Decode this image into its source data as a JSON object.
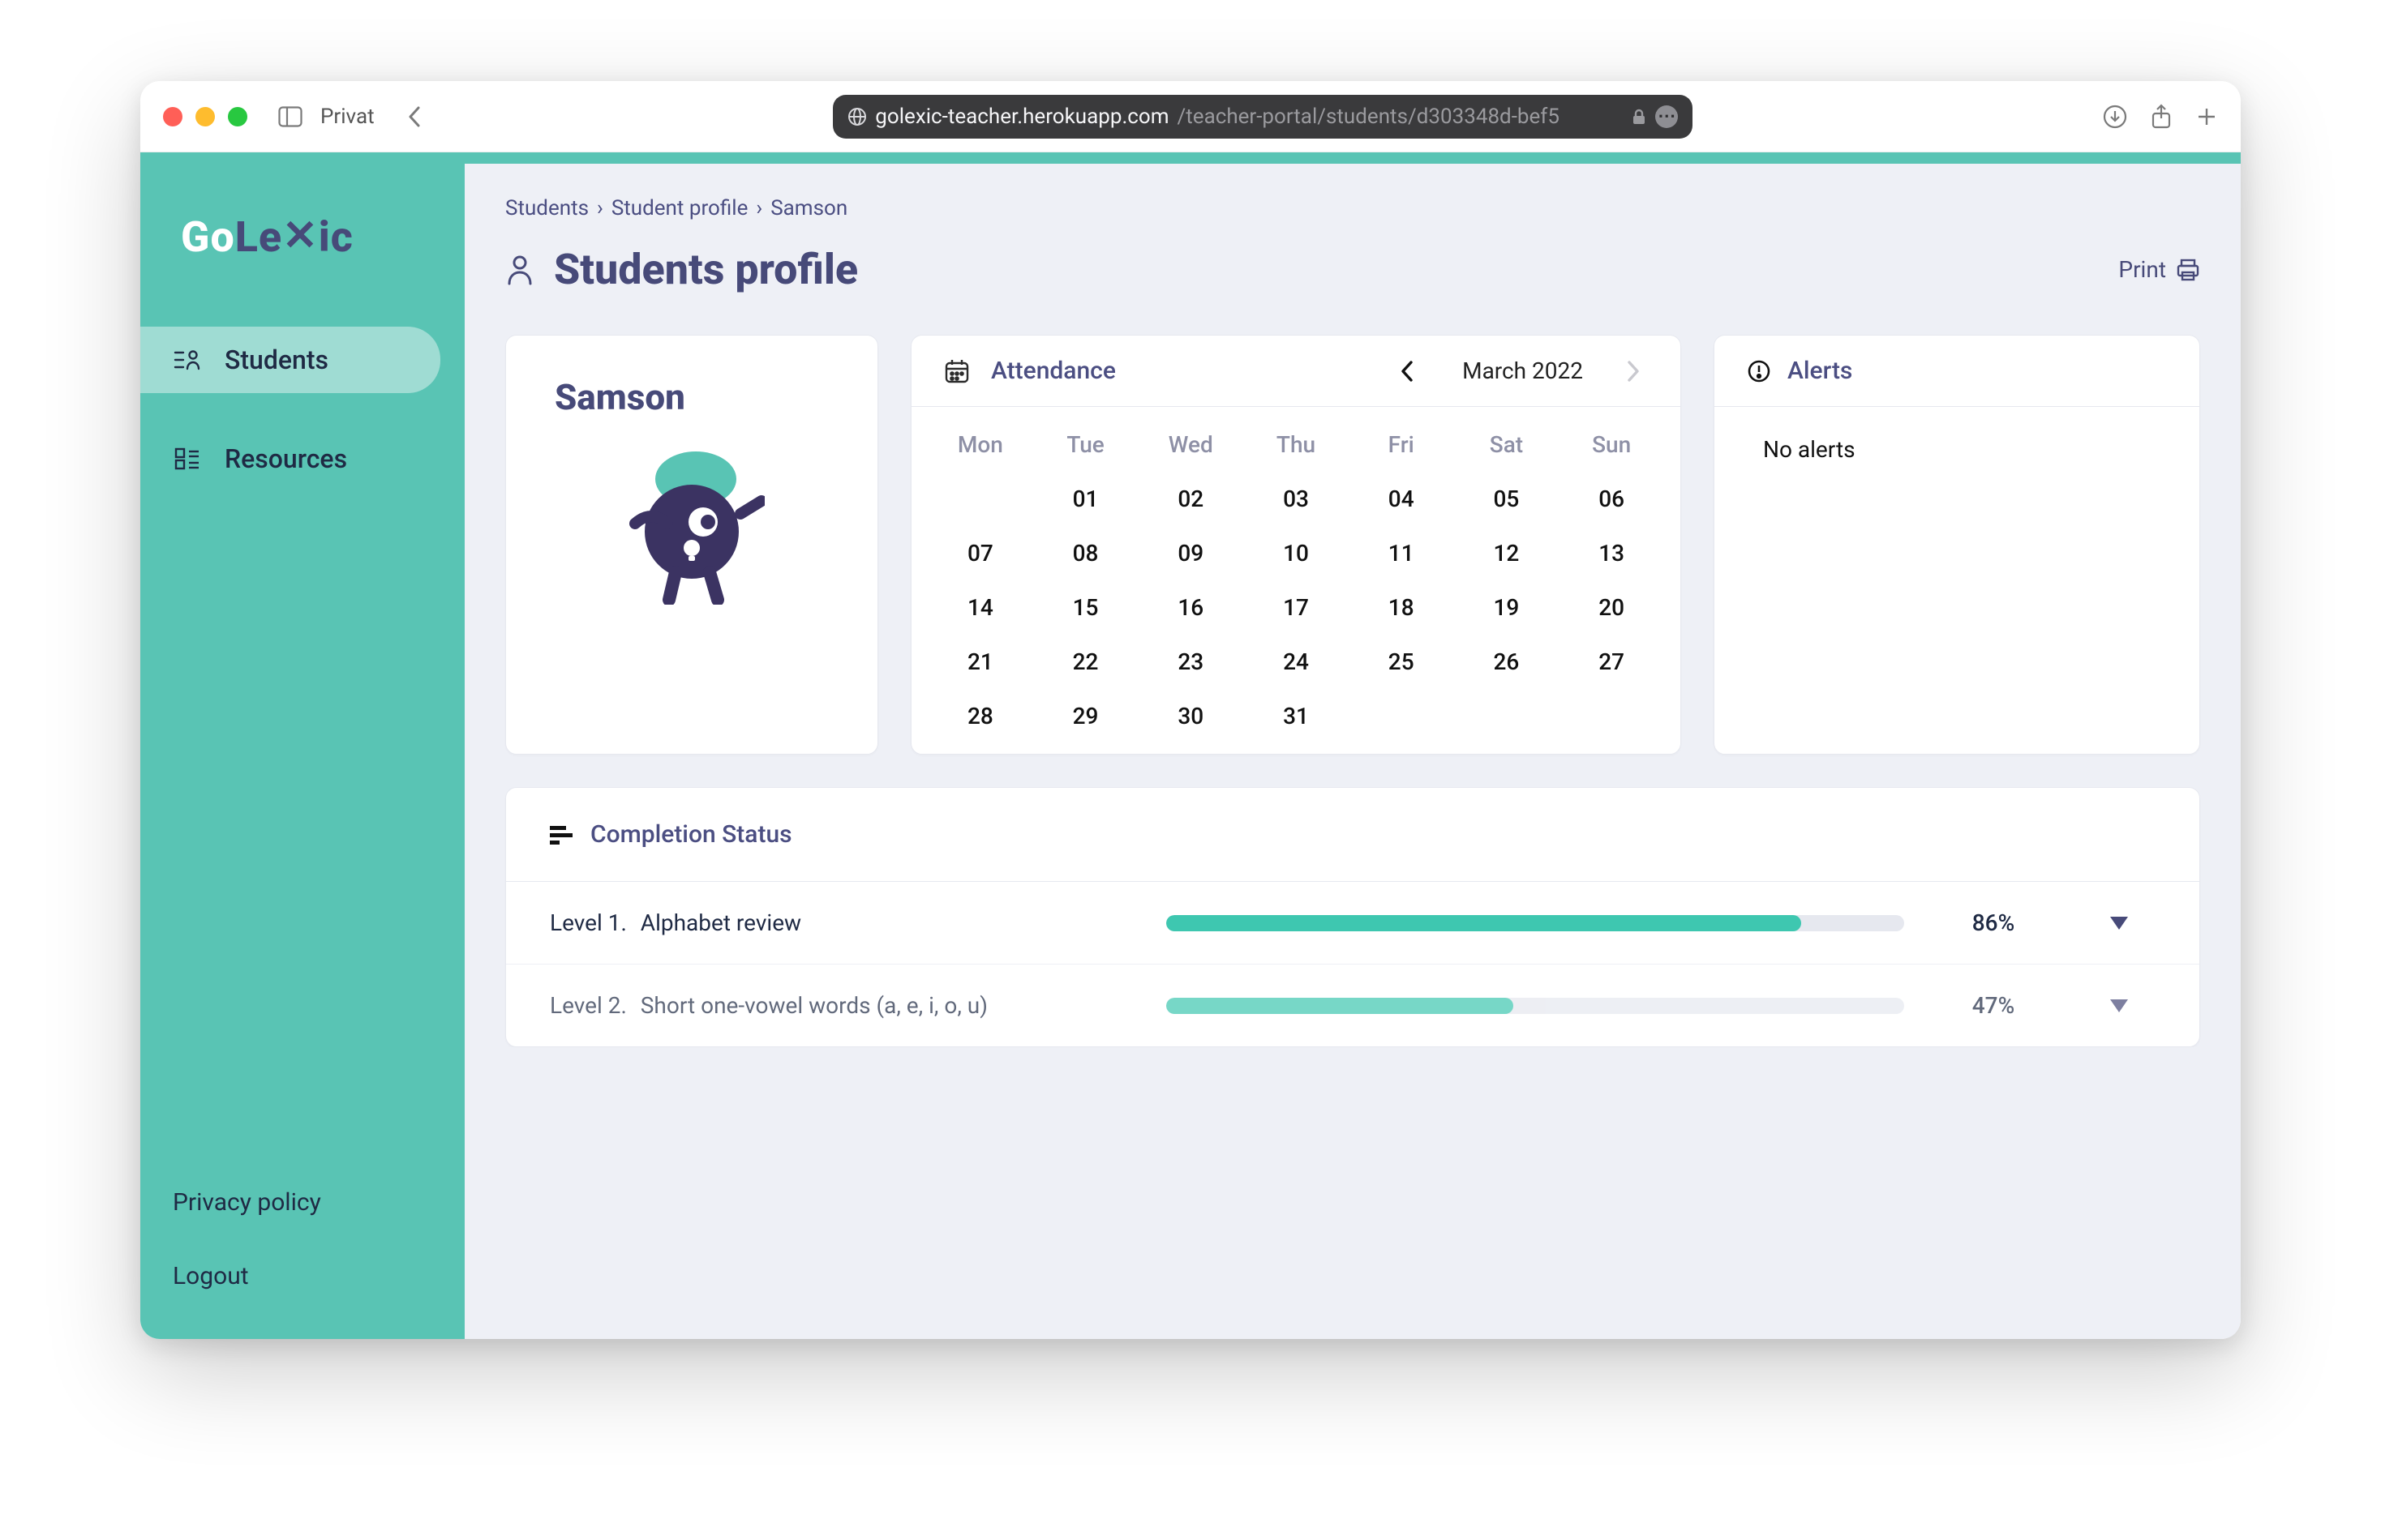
{
  "browser": {
    "privat_label": "Privat",
    "url_host": "golexic-teacher.herokuapp.com",
    "url_path": "/teacher-portal/students/d303348d-bef5"
  },
  "brand": {
    "go": "Go",
    "lex": "Le",
    "x": "✕",
    "ic": "ic"
  },
  "sidebar": {
    "items": [
      {
        "label": "Students",
        "icon": "students-icon",
        "active": true
      },
      {
        "label": "Resources",
        "icon": "resources-icon",
        "active": false
      }
    ],
    "footer": {
      "privacy_label": "Privacy policy",
      "logout_label": "Logout"
    }
  },
  "breadcrumb": {
    "items": [
      "Students",
      "Student profile",
      "Samson"
    ]
  },
  "page_title": "Students profile",
  "print_label": "Print",
  "student": {
    "name": "Samson"
  },
  "attendance": {
    "title": "Attendance",
    "month_label": "March 2022",
    "dow": [
      "Mon",
      "Tue",
      "Wed",
      "Thu",
      "Fri",
      "Sat",
      "Sun"
    ],
    "leading_blanks": 1,
    "days": [
      "01",
      "02",
      "03",
      "04",
      "05",
      "06",
      "07",
      "08",
      "09",
      "10",
      "11",
      "12",
      "13",
      "14",
      "15",
      "16",
      "17",
      "18",
      "19",
      "20",
      "21",
      "22",
      "23",
      "24",
      "25",
      "26",
      "27",
      "28",
      "29",
      "30",
      "31"
    ]
  },
  "alerts": {
    "title": "Alerts",
    "empty_label": "No alerts"
  },
  "completion": {
    "title": "Completion Status",
    "rows": [
      {
        "level": "Level 1.",
        "name": "Alphabet review",
        "pct": 86,
        "pct_label": "86%"
      },
      {
        "level": "Level 2.",
        "name": "Short one-vowel words (a, e, i, o, u)",
        "pct": 47,
        "pct_label": "47%"
      }
    ]
  },
  "colors": {
    "accent": "#3ec7b0"
  }
}
